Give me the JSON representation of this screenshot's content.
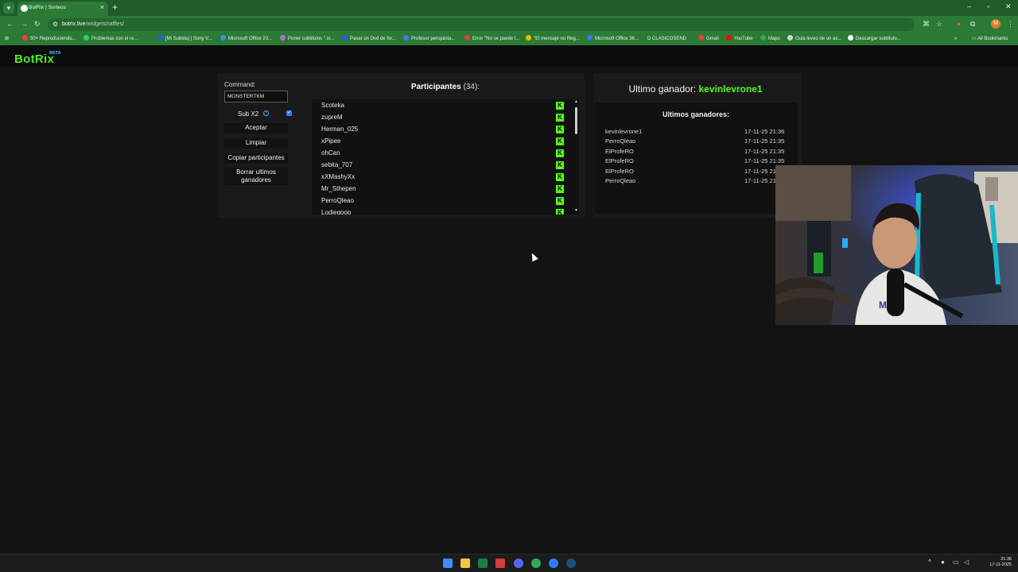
{
  "browser": {
    "tab_title": "BotRix | Sorteos",
    "url_host": "botrix.live",
    "url_path": "/widgets/raffles/",
    "profile_initial": "M",
    "bookmarks": [
      "50+ Reproduciendo...",
      "Problemas con el re...",
      "[Mi Subida] | Sony V...",
      "Microsoft Office 20...",
      "Poner subtitulos \".sr...",
      "Pasar un Dvd de for...",
      "Profesor penquista...",
      "Error \"No se puede l...",
      "\"El mensaje no Reg...",
      "Microsoft Office 36...",
      "D CLASICOSEND",
      "Gmail",
      "YouTube",
      "Maps",
      "Guia leveo de un as...",
      "Descargar subtitulo..."
    ],
    "all_bookmarks": "All Bookmarks"
  },
  "site": {
    "logo": "BotRix",
    "logo_badge": "BETA"
  },
  "raffle": {
    "command_label": "Command:",
    "command_value": "MONSTERTKM",
    "sub_label": "Sub X2",
    "sub_checked": true,
    "buttons": {
      "accept": "Aceptar",
      "clear": "Limpiar",
      "copy": "Copiar participantes",
      "delete_line1": "Borrar ultimos",
      "delete_line2": "ganadores"
    },
    "participants_title": "Participantes",
    "participants_count": "(34):",
    "participants": [
      "Scoteka",
      "zupreM",
      "Herman_025",
      "xPipee",
      "ohCan",
      "sebita_707",
      "xXMashyXx",
      "Mr_Sthepen",
      "PerroQleao",
      "Lodiegooo"
    ],
    "platform_badge_letter": "K",
    "winner_title": "Ultimo ganador:",
    "winner_name": "kevinlevrone1",
    "last_winners_title": "Ultimos ganadores:",
    "last_winners": [
      {
        "name": "kevinlevrone1",
        "date": "17-11-25 21:36"
      },
      {
        "name": "PerroQleao",
        "date": "17-11-25 21:35"
      },
      {
        "name": "ElProfeRO",
        "date": "17-11-25 21:35"
      },
      {
        "name": "ElProfeRO",
        "date": "17-11-25 21:35"
      },
      {
        "name": "ElProfeRO",
        "date": "17-11-25 21:35"
      },
      {
        "name": "PerroQleao",
        "date": "17-11-25 21:35"
      }
    ]
  },
  "taskbar": {
    "time": "21:36",
    "date": "17-11-2025"
  },
  "colors": {
    "browser_green": "#2b7a36",
    "kick_green": "#53fc18",
    "page_bg": "#131313"
  }
}
